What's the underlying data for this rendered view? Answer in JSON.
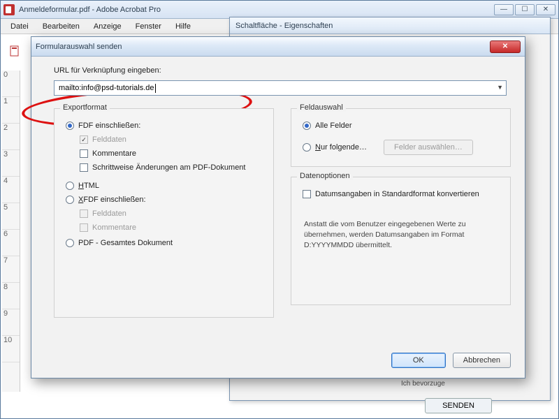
{
  "app": {
    "title": "Anmeldeformular.pdf - Adobe Acrobat Pro",
    "menus": [
      "Datei",
      "Bearbeiten",
      "Anzeige",
      "Fenster",
      "Hilfe"
    ]
  },
  "properties_window": {
    "title": "Schaltfläche - Eigenschaften"
  },
  "dialog": {
    "title": "Formularauswahl senden",
    "url_label": "URL für Verknüpfung eingeben:",
    "url_value": "mailto:info@psd-tutorials.de",
    "export": {
      "legend": "Exportformat",
      "fdf": "FDF einschließen:",
      "fdf_fielddata": "Felddaten",
      "fdf_comments": "Kommentare",
      "fdf_incremental": "Schrittweise Änderungen am PDF-Dokument",
      "html": "HTML",
      "xfdf": "XFDF einschließen:",
      "xfdf_fielddata": "Felddaten",
      "xfdf_comments": "Kommentare",
      "pdf": "PDF - Gesamtes Dokument"
    },
    "fields": {
      "legend": "Feldauswahl",
      "all": "Alle Felder",
      "only": "Nur folgende…",
      "select_btn": "Felder auswählen…"
    },
    "dateopts": {
      "legend": "Datenoptionen",
      "convert": "Datumsangaben in Standardformat konvertieren",
      "note": "Anstatt die vom Benutzer eingegebenen Werte zu übernehmen, werden Datumsangaben im Format D:YYYYMMDD übermittelt."
    },
    "ok": "OK",
    "cancel": "Abbrechen"
  },
  "bottom": {
    "hint": "Ich bevorzuge",
    "send": "SENDEN"
  }
}
